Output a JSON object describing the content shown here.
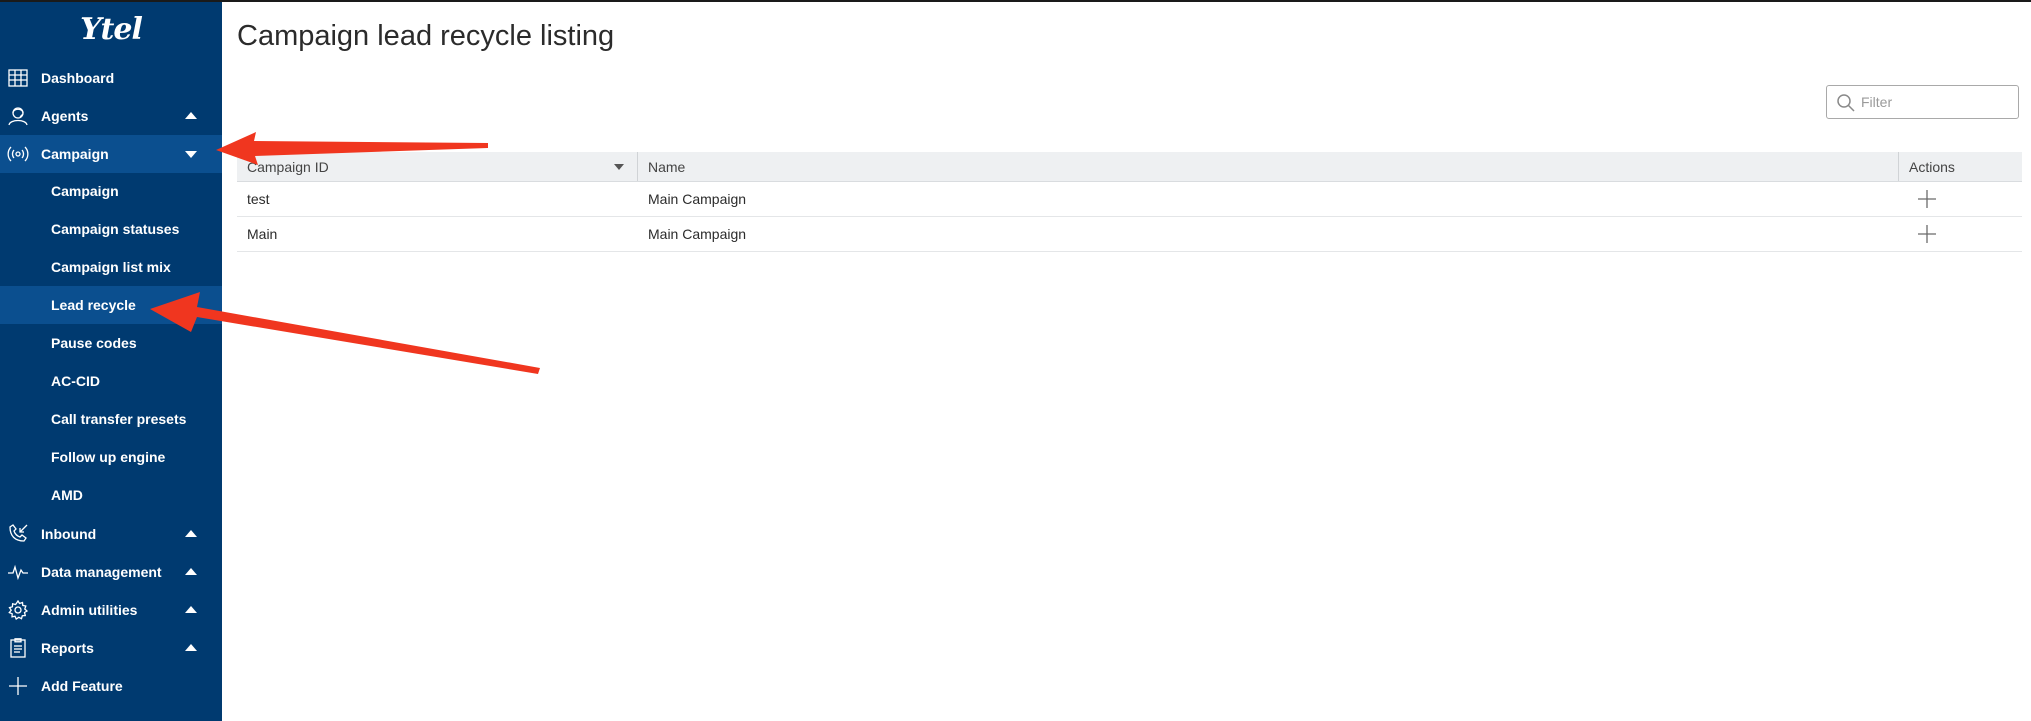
{
  "brand": {
    "logo_text": "Ytel"
  },
  "sidebar": {
    "items": [
      {
        "label": "Dashboard",
        "icon": "dashboard-icon"
      },
      {
        "label": "Agents",
        "icon": "agents-icon",
        "expanded": false
      },
      {
        "label": "Campaign",
        "icon": "campaign-icon",
        "expanded": true,
        "active": true
      },
      {
        "label": "Inbound",
        "icon": "inbound-icon",
        "expanded": false
      },
      {
        "label": "Data management",
        "icon": "data-management-icon",
        "expanded": false
      },
      {
        "label": "Admin utilities",
        "icon": "admin-utilities-icon",
        "expanded": false
      },
      {
        "label": "Reports",
        "icon": "reports-icon",
        "expanded": false
      },
      {
        "label": "Add Feature",
        "icon": "plus-icon"
      }
    ],
    "campaign_subitems": [
      {
        "label": "Campaign"
      },
      {
        "label": "Campaign statuses"
      },
      {
        "label": "Campaign list mix"
      },
      {
        "label": "Lead recycle",
        "active": true
      },
      {
        "label": "Pause codes"
      },
      {
        "label": "AC-CID"
      },
      {
        "label": "Call transfer presets"
      },
      {
        "label": "Follow up engine"
      },
      {
        "label": "AMD"
      }
    ]
  },
  "main": {
    "title": "Campaign lead recycle listing",
    "filter": {
      "placeholder": "Filter",
      "value": ""
    },
    "table": {
      "columns": [
        "Campaign ID",
        "Name",
        "Actions"
      ],
      "rows": [
        {
          "campaign_id": "test",
          "name": "Main Campaign",
          "action_icon": "plus-icon"
        },
        {
          "campaign_id": "Main",
          "name": "Main Campaign",
          "action_icon": "plus-icon"
        }
      ]
    }
  },
  "colors": {
    "sidebar_bg": "#003a70",
    "sidebar_active": "#0b4f8f",
    "annotation_arrow": "#f0361f"
  }
}
